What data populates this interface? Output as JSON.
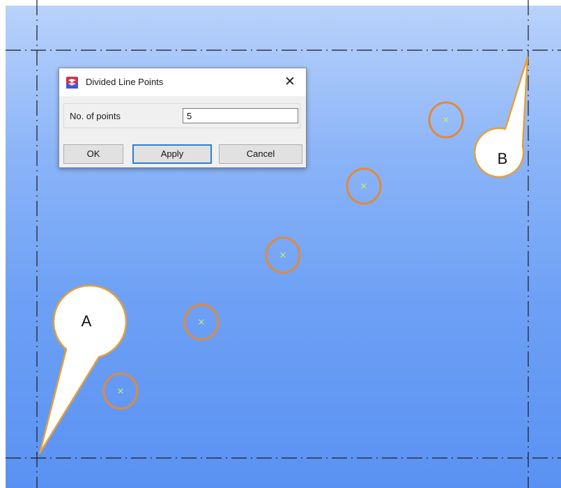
{
  "dialog": {
    "title": "Divided Line Points",
    "close_glyph": "✕",
    "icon": "app-logo-icon",
    "points_label": "No. of points",
    "points_value": "5",
    "buttons": {
      "ok": "OK",
      "apply": "Apply",
      "cancel": "Cancel"
    }
  },
  "callouts": {
    "a": "A",
    "b": "B"
  },
  "markers": {
    "count": 5,
    "glyph": "×",
    "marker_color": "#c8f06a",
    "ring_color": "#e08a3c"
  },
  "colors": {
    "viewport_top": "#b9d2fb",
    "viewport_bottom": "#5a92f3",
    "callout_fill": "#ffffff",
    "callout_stroke": "#e3a03a",
    "guide_line": "#1a1a1a"
  }
}
